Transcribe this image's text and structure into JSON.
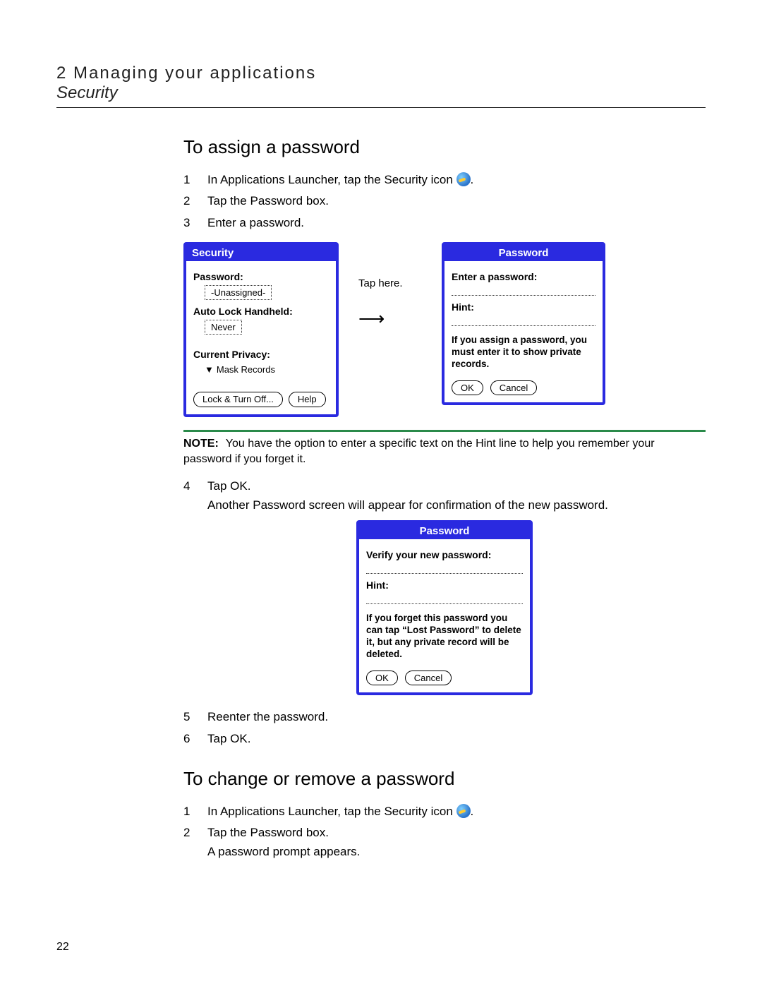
{
  "header": {
    "chapter_num": "2",
    "chapter_title": "Managing your applications",
    "section": "Security"
  },
  "heading1": "To assign a password",
  "steps1": [
    "In Applications Launcher, tap the Security icon",
    "Tap the Password box.",
    "Enter a password."
  ],
  "steps1_tail": ".",
  "fig1": {
    "security": {
      "title": "Security",
      "password_label": "Password:",
      "password_value": "-Unassigned-",
      "autolock_label": "Auto Lock Handheld:",
      "autolock_value": "Never",
      "privacy_label": "Current Privacy:",
      "privacy_value": "Mask Records",
      "lock_btn": "Lock & Turn Off...",
      "help_btn": "Help"
    },
    "callout": "Tap here.",
    "password": {
      "title": "Password",
      "enter_label": "Enter a password:",
      "hint_label": "Hint:",
      "warn": "If you assign a password, you must enter it to show private records.",
      "ok": "OK",
      "cancel": "Cancel"
    }
  },
  "note": {
    "label": "NOTE:",
    "text": "You have the option to enter a specific text on the Hint line to help you remember your password if you forget it."
  },
  "step4_num": "4",
  "step4": "Tap OK.",
  "step4_after": "Another Password screen will appear for confirmation of the new password.",
  "fig2": {
    "title": "Password",
    "verify_label": "Verify your new password:",
    "hint_label": "Hint:",
    "warn": "If you forget this password you can tap “Lost Password” to delete it, but any private record will be deleted.",
    "ok": "OK",
    "cancel": "Cancel"
  },
  "steps_after": [
    {
      "n": "5",
      "t": "Reenter the password."
    },
    {
      "n": "6",
      "t": "Tap OK."
    }
  ],
  "heading2": "To change or remove a password",
  "steps2": [
    {
      "n": "1",
      "t": "In Applications Launcher, tap the Security icon"
    },
    {
      "n": "2",
      "t": "Tap the Password box."
    }
  ],
  "steps2_tail": ".",
  "steps2_sub": "A password prompt appears.",
  "page_number": "22"
}
